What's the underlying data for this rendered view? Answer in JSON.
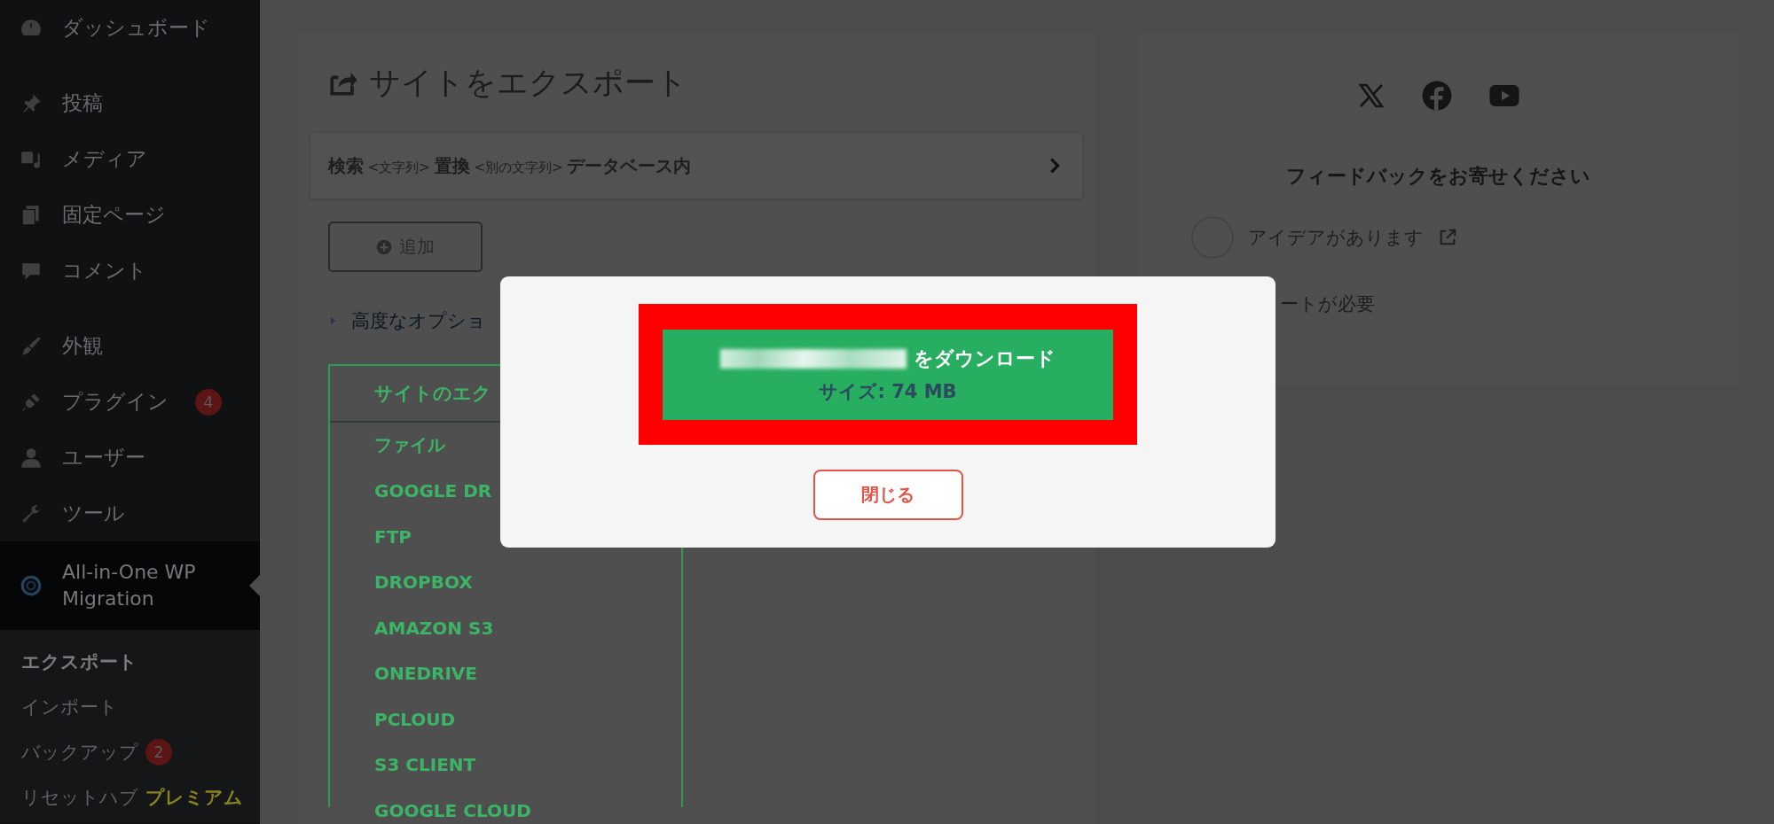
{
  "sidebar": {
    "groups": [
      {
        "items": [
          {
            "label": "ダッシュボード",
            "selected": false
          }
        ]
      },
      {
        "items": [
          {
            "label": "投稿",
            "selected": false
          },
          {
            "label": "メディア",
            "selected": false
          },
          {
            "label": "固定ページ",
            "selected": false
          },
          {
            "label": "コメント",
            "selected": false
          }
        ]
      },
      {
        "items": [
          {
            "label": "外観",
            "selected": false
          },
          {
            "label": "プラグイン",
            "badge": "4",
            "selected": false
          },
          {
            "label": "ユーザー",
            "selected": false
          },
          {
            "label": "ツール",
            "selected": false
          },
          {
            "label": "All-in-One WP Migration",
            "selected": true,
            "children": [
              {
                "label": "エクスポート",
                "selected": true
              },
              {
                "label": "インポート",
                "selected": false
              },
              {
                "label": "バックアップ",
                "badge": "2",
                "selected": false
              },
              {
                "label": "リセットハブ",
                "tag": "プレミアム",
                "selected": false
              }
            ]
          }
        ]
      }
    ]
  },
  "export_panel": {
    "title": "サイトをエクスポート",
    "search_replace": "**検索** <文字列> **置換** <別の文字列> **データベース内**",
    "add_button": "追加",
    "advanced_options": "高度なオプショ",
    "export_menu": {
      "header": "サイトのエク",
      "items": [
        "ファイル",
        "GOOGLE DR",
        "FTP",
        "DROPBOX",
        "AMAZON S3",
        "ONEDRIVE",
        "PCLOUD",
        "S3 CLIENT",
        "GOOGLE CLOUD"
      ]
    }
  },
  "feedback_panel": {
    "heading": "フィードバックをお寄せください",
    "options": [
      {
        "label": "アイデアがあります",
        "external": true,
        "selected": false
      },
      {
        "label": "ートが必要",
        "external": false
      }
    ]
  },
  "modal": {
    "download_button": {
      "label": "をダウンロード",
      "size": "サイズ: 74 MB"
    },
    "close_button": "閉じる"
  }
}
